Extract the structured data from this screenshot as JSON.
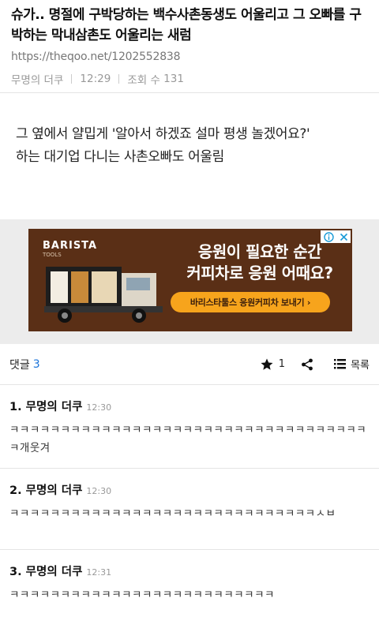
{
  "post": {
    "title": "슈가.. 명절에 구박당하는 백수사촌동생도 어울리고 그 오빠를 구박하는 막내삼촌도 어울리는 새럼",
    "url": "https://theqoo.net/1202552838",
    "author": "무명의 더쿠",
    "time": "12:29",
    "views_label": "조회 수",
    "views": "131",
    "body_line1": "그 옆에서 얄밉게 '알아서 하겠죠 설마 평생 놀겠어요?'",
    "body_line2": "하는 대기업 다니는 사촌오빠도 어울림"
  },
  "ad": {
    "brand": "BARISTA",
    "brand_sub": "TOOLS",
    "headline1": "응원이 필요한 순간",
    "headline2": "커피차로 응원 어때요?",
    "cta": "바리스타툴스 응원커피차 보내기",
    "bg_color": "#5a2f16",
    "cta_color": "#f7a41c"
  },
  "comments_bar": {
    "label": "댓글",
    "count": "3",
    "star_count": "1",
    "list_label": "목록"
  },
  "comments": [
    {
      "index": "1.",
      "author": "무명의 더쿠",
      "time": "12:30",
      "text": "ㅋㅋㅋㅋㅋㅋㅋㅋㅋㅋㅋㅋㅋㅋㅋㅋㅋㅋㅋㅋㅋㅋㅋㅋㅋㅋㅋㅋㅋㅋㅋㅋㅋㅋㅋㅋ개웃겨"
    },
    {
      "index": "2.",
      "author": "무명의 더쿠",
      "time": "12:30",
      "text": "ㅋㅋㅋㅋㅋㅋㅋㅋㅋㅋㅋㅋㅋㅋㅋㅋㅋㅋㅋㅋㅋㅋㅋㅋㅋㅋㅋㅋㅋㅋㅅㅂ"
    },
    {
      "index": "3.",
      "author": "무명의 더쿠",
      "time": "12:31",
      "text": "ㅋㅋㅋㅋㅋㅋㅋㅋㅋㅋㅋㅋㅋㅋㅋㅋㅋㅋㅋㅋㅋㅋㅋㅋㅋㅋ"
    }
  ]
}
